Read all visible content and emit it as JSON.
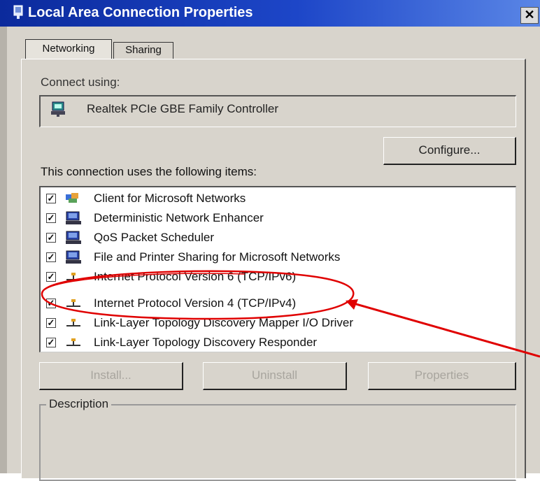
{
  "window": {
    "title": "Local Area Connection Properties",
    "close_label": "✕"
  },
  "tabs": [
    {
      "label": "Networking"
    },
    {
      "label": "Sharing"
    }
  ],
  "connect_using": {
    "label": "Connect using:",
    "adapter": "Realtek PCIe GBE Family Controller",
    "icon": "network-adapter-icon"
  },
  "configure_label": "Configure...",
  "items_heading": "This connection uses the following items:",
  "items": [
    {
      "label": "Client for Microsoft Networks",
      "checked": true,
      "icon": "network-client-icon"
    },
    {
      "label": "Deterministic Network Enhancer",
      "checked": true,
      "icon": "service-icon"
    },
    {
      "label": "QoS Packet Scheduler",
      "checked": true,
      "icon": "service-icon"
    },
    {
      "label": "File and Printer Sharing for Microsoft Networks",
      "checked": true,
      "icon": "service-icon"
    },
    {
      "label": "Internet Protocol Version 6 (TCP/IPv6)",
      "checked": true,
      "icon": "protocol-icon"
    },
    {
      "label": "Internet Protocol Version 4 (TCP/IPv4)",
      "checked": true,
      "icon": "protocol-icon"
    },
    {
      "label": "Link-Layer Topology Discovery Mapper I/O Driver",
      "checked": true,
      "icon": "protocol-icon"
    },
    {
      "label": "Link-Layer Topology Discovery Responder",
      "checked": true,
      "icon": "protocol-icon"
    }
  ],
  "buttons": {
    "install": "Install...",
    "uninstall": "Uninstall",
    "properties": "Properties"
  },
  "description_label": "Description",
  "colors": {
    "title_bar": "#1d46c8",
    "dialog_bg": "#d8d4cc",
    "annotation": "#e00000"
  }
}
